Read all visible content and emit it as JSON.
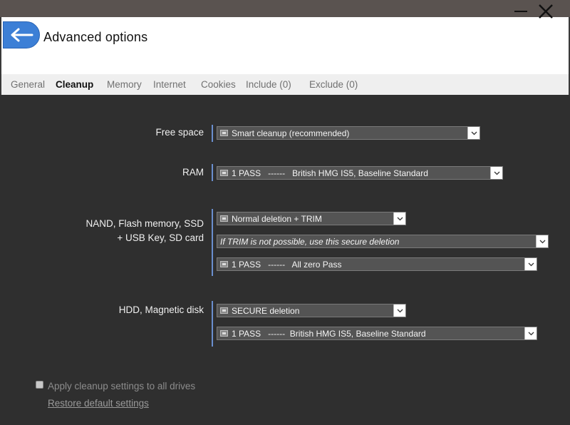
{
  "window": {
    "title": "Advanced options"
  },
  "tabs": [
    {
      "label": "General"
    },
    {
      "label": "Cleanup",
      "active": true
    },
    {
      "label": "Memory"
    },
    {
      "label": "Internet"
    },
    {
      "label": "Cookies"
    },
    {
      "label": "Include (0)"
    },
    {
      "label": "Exclude (0)"
    }
  ],
  "sections": {
    "free_space": {
      "label": "Free space",
      "select": "Smart cleanup (recommended)"
    },
    "ram": {
      "label": "RAM",
      "select": "1 PASS   ------   British HMG IS5, Baseline Standard"
    },
    "nand": {
      "label_line1": "NAND, Flash memory, SSD",
      "label_line2": "+ USB Key, SD card",
      "select_method": "Normal deletion + TRIM",
      "select_fallback": "If TRIM is not possible, use this secure deletion",
      "select_pass": "1 PASS   ------   All zero Pass"
    },
    "hdd": {
      "label": "HDD, Magnetic disk",
      "select_method": "SECURE deletion",
      "select_pass": "1 PASS   ------  British HMG IS5, Baseline Standard"
    }
  },
  "footer": {
    "apply_label": "Apply cleanup settings to all drives",
    "apply_checked": false,
    "restore_link": "Restore default settings"
  },
  "icons": {
    "back": "arrow-left-icon",
    "minimize": "minimize-icon",
    "close": "close-icon",
    "dropdown": "chevron-down-icon",
    "drive": "drive-icon"
  },
  "colors": {
    "accent": "#3c7fd6",
    "section_bar": "#6a8fcf",
    "content_bg": "#2f2f2f"
  }
}
